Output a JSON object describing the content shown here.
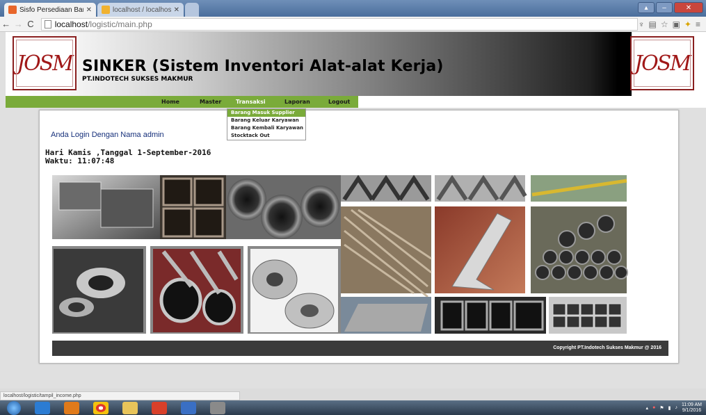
{
  "browser": {
    "tabs": [
      {
        "title": "Sisfo Persediaan Barang",
        "favicon": "orange-square-icon",
        "active": true
      },
      {
        "title": "localhost / localhost / log",
        "favicon": "phpmyadmin-icon",
        "active": false
      }
    ],
    "url_host": "localhost",
    "url_path": "/logistic/main.php",
    "status_url": "localhost/logistic/tampil_income.php"
  },
  "site": {
    "logo_text": "JOSM",
    "title": "SINKER (Sistem Inventori Alat-alat Kerja)",
    "company": "PT.INDOTECH SUKSES MAKMUR"
  },
  "nav": {
    "items": [
      {
        "label": "Home"
      },
      {
        "label": "Master"
      },
      {
        "label": "Transaksi",
        "active": true
      },
      {
        "label": "Laporan"
      },
      {
        "label": "Logout"
      }
    ],
    "dropdown": [
      {
        "label": "Barang Masuk Supplier",
        "highlighted": true
      },
      {
        "label": "Barang Keluar Karyawan"
      },
      {
        "label": "Barang Kembali Karyawan"
      },
      {
        "label": "Stocktack Out"
      }
    ]
  },
  "content": {
    "welcome": "Anda Login Dengan Nama admin",
    "date_line": "Hari Kamis ,Tanggal 1-September-2016",
    "time_line": "Waktu: 11:07:48",
    "footer": "Copyright PT.Indotech Sukses Makmur @ 2016"
  },
  "taskbar": {
    "time": "11:09 AM",
    "date": "9/1/2016"
  },
  "colors": {
    "nav_green": "#7aab3a",
    "welcome_blue": "#152f7a",
    "footer_bg": "#3b3b3b",
    "logo_red": "#a01818"
  }
}
